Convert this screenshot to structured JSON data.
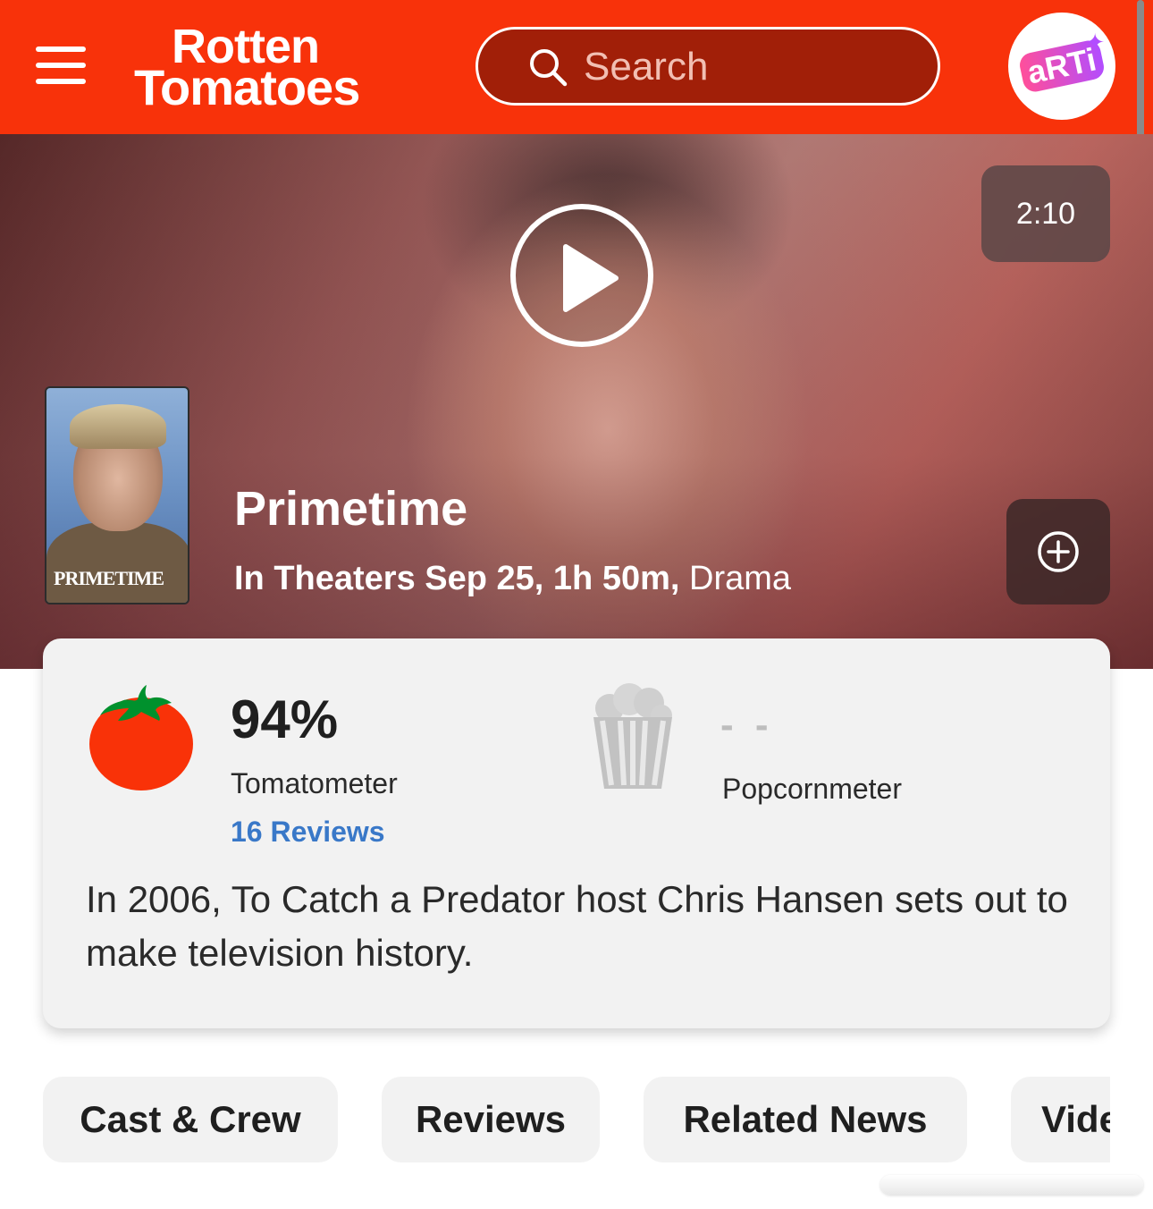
{
  "header": {
    "logo_line1": "Rotten",
    "logo_line2": "Tomatoes",
    "search_placeholder": "Search",
    "avatar_text": "aRTi",
    "brand_color": "#f8320a"
  },
  "hero": {
    "duration": "2:10",
    "title": "Primetime",
    "release": "In Theaters Sep 25, 1h 50m,",
    "genre": "Drama",
    "poster_text": "PRIMETIME"
  },
  "scores": {
    "tomatometer_value": "94%",
    "tomatometer_label": "Tomatometer",
    "reviews_link": "16 Reviews",
    "popcornmeter_value": "- -",
    "popcornmeter_label": "Popcornmeter"
  },
  "synopsis": "In 2006, To Catch a Predator host Chris Hansen sets out to make television history.",
  "tabs": [
    {
      "label": "Cast & Crew"
    },
    {
      "label": "Reviews"
    },
    {
      "label": "Related News"
    },
    {
      "label": "Videos"
    }
  ]
}
